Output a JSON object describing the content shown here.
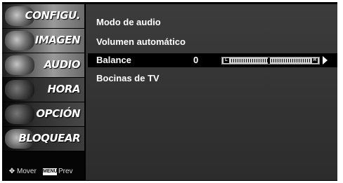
{
  "sidebar": {
    "tabs": [
      {
        "label": "CONFIGU.",
        "icon": "config-art-icon"
      },
      {
        "label": "IMAGEN",
        "icon": "film-art-icon"
      },
      {
        "label": "AUDIO",
        "icon": "speaker-art-icon"
      },
      {
        "label": "HORA",
        "icon": "clock-art-icon"
      },
      {
        "label": "OPCIÓN",
        "icon": "option-art-icon"
      },
      {
        "label": "BLOQUEAR",
        "icon": "lock-art-icon"
      }
    ],
    "hints": {
      "move_label": "Mover",
      "menu_key": "MENU",
      "prev_label": "Prev"
    }
  },
  "menu": {
    "items": [
      "Modo de audio",
      "Volumen automático",
      "Balance",
      "Bocinas de TV"
    ],
    "selected": "Balance",
    "balance_value": "0",
    "slider": {
      "left_label": "L",
      "right_label": "R",
      "position": 0
    }
  }
}
